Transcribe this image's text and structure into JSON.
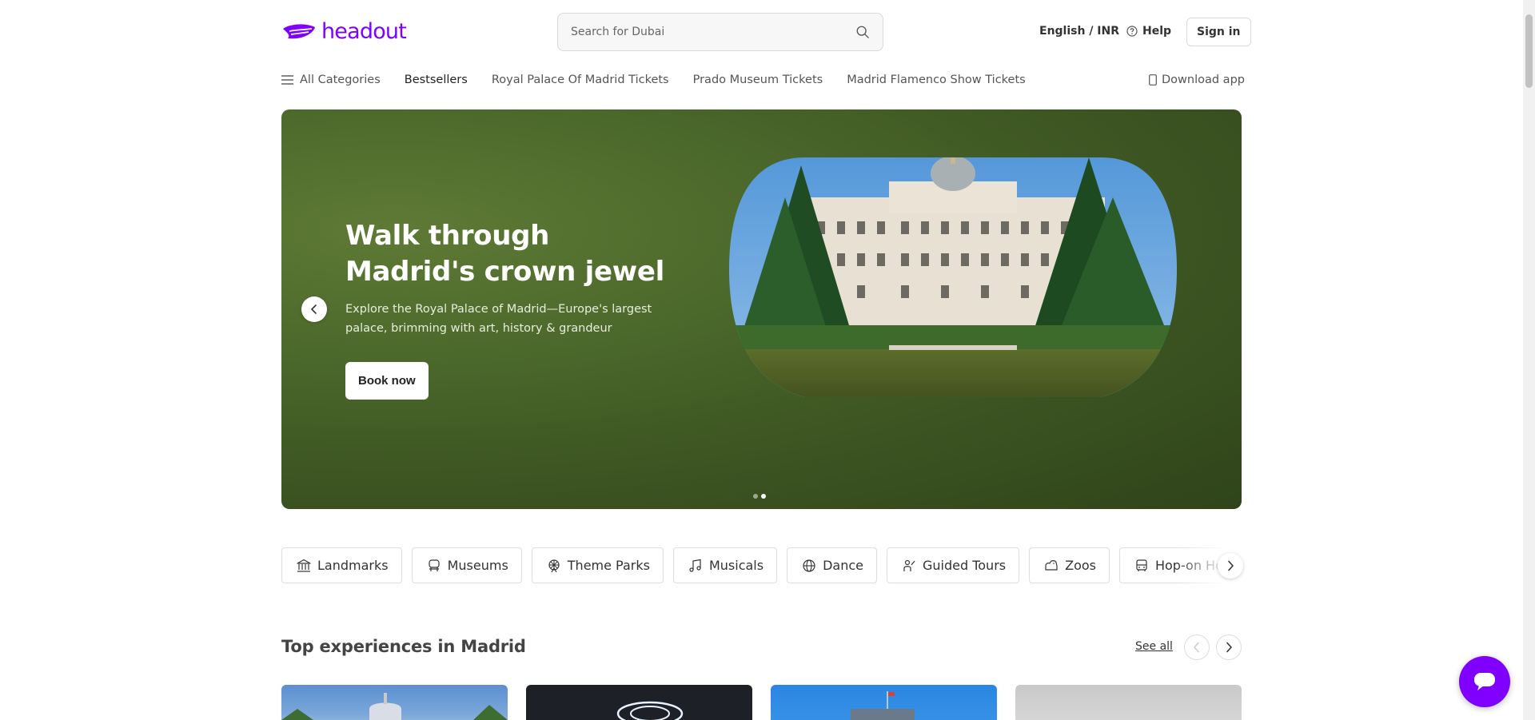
{
  "header": {
    "logo_text": "headout",
    "search_placeholder": "Search for Dubai",
    "language_currency": "English / INR",
    "help_label": "Help",
    "signin_label": "Sign in"
  },
  "nav": {
    "all_categories": "All Categories",
    "items": [
      "Bestsellers",
      "Royal Palace Of Madrid Tickets",
      "Prado Museum Tickets",
      "Madrid Flamenco Show Tickets"
    ],
    "download_app": "Download app"
  },
  "hero": {
    "title": "Walk through Madrid's crown jewel",
    "description": "Explore the Royal Palace of Madrid—Europe's largest palace, brimming with art, history & grandeur",
    "button_label": "Book now",
    "slide_count": 2,
    "active_slide": 2
  },
  "categories": [
    "Landmarks",
    "Museums",
    "Theme Parks",
    "Musicals",
    "Dance",
    "Guided Tours",
    "Zoos",
    "Hop-on Hop-off"
  ],
  "section": {
    "title": "Top experiences in Madrid",
    "see_all": "See all"
  },
  "colors": {
    "brand": "#8000ff",
    "hero_bg": "#4d6a2c"
  }
}
